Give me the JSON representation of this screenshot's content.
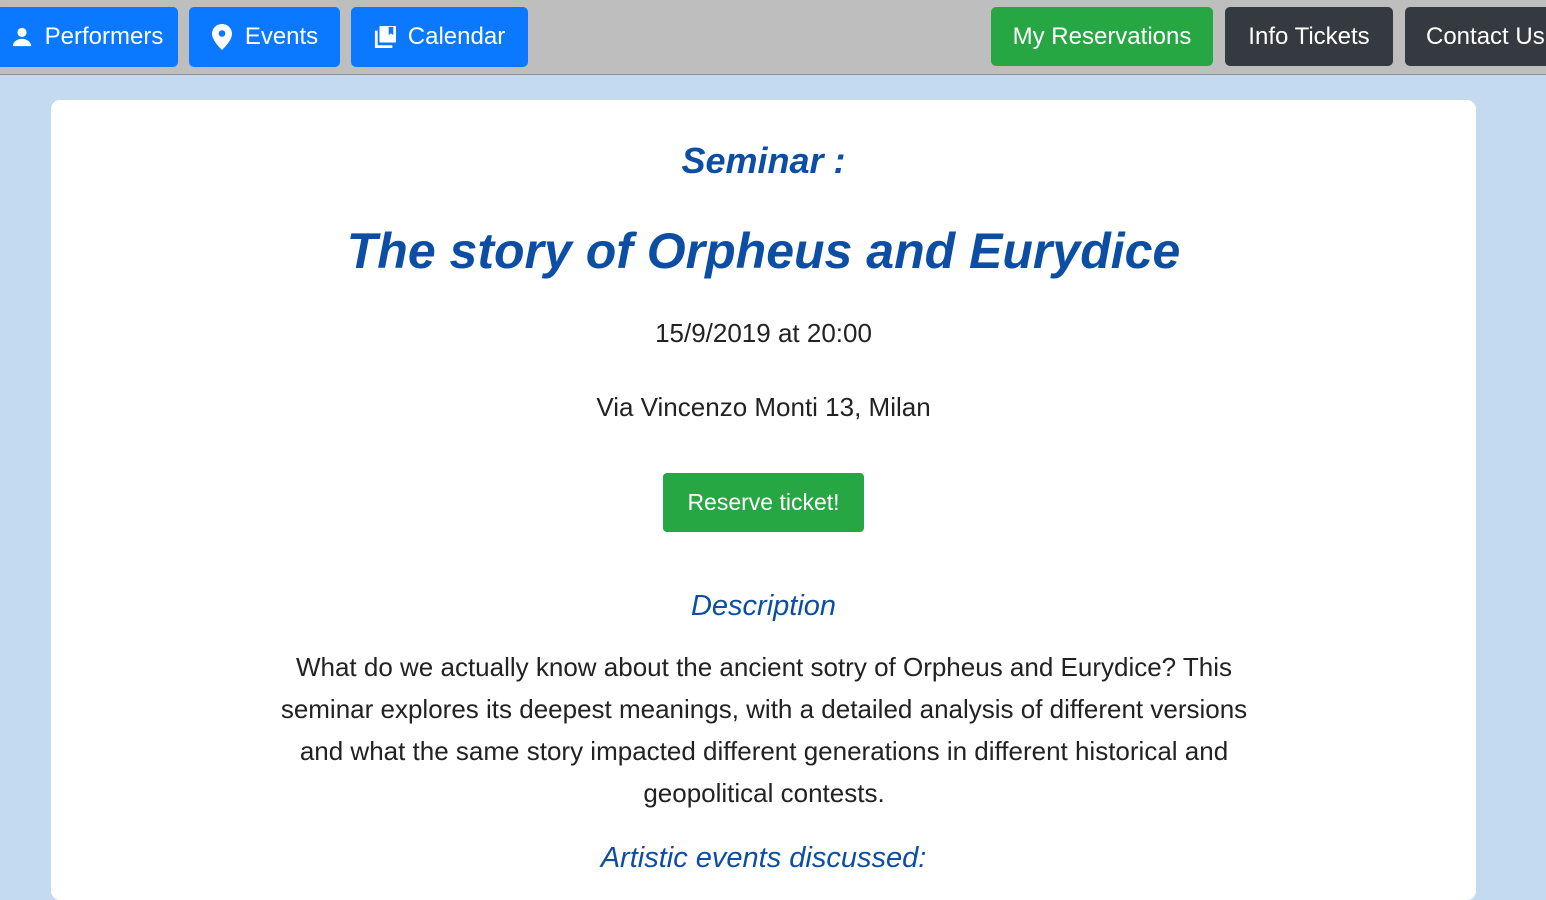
{
  "nav": {
    "performers_label": "Performers",
    "events_label": "Events",
    "calendar_label": "Calendar",
    "reservations_label": "My Reservations",
    "info_tickets_label": "Info Tickets",
    "contact_label": "Contact Us",
    "performers_icon": "person-icon",
    "events_icon": "map-pin-icon",
    "calendar_icon": "library-books-icon"
  },
  "event": {
    "type_label": "Seminar :",
    "title": "The story of Orpheus and Eurydice",
    "datetime": "15/9/2019 at 20:00",
    "location": "Via Vincenzo Monti 13, Milan",
    "reserve_label": "Reserve ticket!",
    "description_heading": "Description",
    "description": "What do we actually know about the ancient sotry of Orpheus and Eurydice? This seminar explores its deepest meanings, with a detailed analysis of different versions and what the same story impacted different generations in different historical and geopolitical contests.",
    "artistic_heading": "Artistic events discussed:"
  },
  "colors": {
    "nav_blue": "#0a78ff",
    "nav_green": "#27a744",
    "nav_dark": "#343a40",
    "heading_blue": "#0d4ea5",
    "page_background": "#c3daf0"
  }
}
